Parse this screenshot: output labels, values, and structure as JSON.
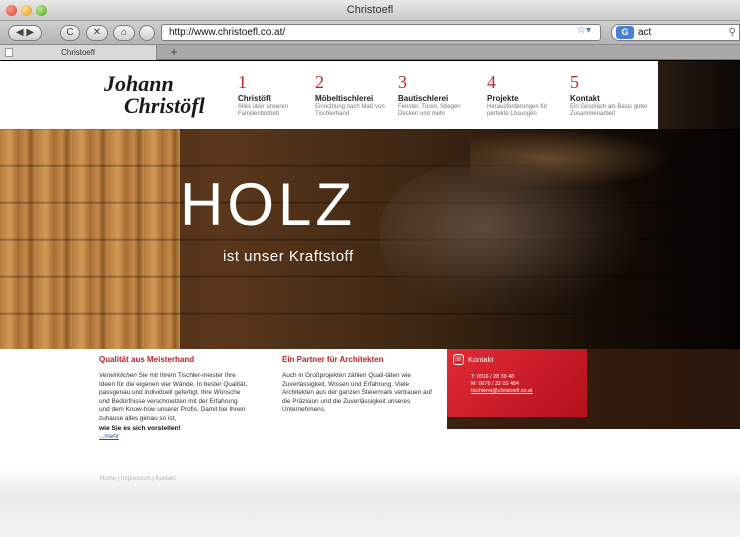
{
  "window": {
    "title": "Christoefl"
  },
  "toolbar": {
    "url": "http://www.christoefl.co.at/",
    "search_value": "act",
    "search_engine_letter": "G",
    "back_label": "◀ ▶",
    "reload_label": "C",
    "stop_label": "✕",
    "home_label": "⌂",
    "star_label": "☆▾"
  },
  "tabs": [
    {
      "label": "Christoefl"
    }
  ],
  "newtab_label": "+",
  "logo": {
    "line1": "Johann",
    "line2": "Christöfl"
  },
  "nav": [
    {
      "num": "1",
      "title": "Christöfl",
      "sub": "Alles über unseren Familienbetrieb"
    },
    {
      "num": "2",
      "title": "Möbeltischlerei",
      "sub": "Einrichtung nach Maß von Tischlerhand"
    },
    {
      "num": "3",
      "title": "Bautischlerei",
      "sub": "Fenster, Türen, Stiegen Decken und mehr"
    },
    {
      "num": "4",
      "title": "Projekte",
      "sub": "Herausforderungen für perfekte Lösungen"
    },
    {
      "num": "5",
      "title": "Kontakt",
      "sub": "Ein Gespräch als Basis guter Zusammenarbeit"
    }
  ],
  "hero": {
    "title": "HOLZ",
    "subtitle": "ist unser Kraftstoff"
  },
  "col1": {
    "title": "Qualität aus Meisterhand",
    "lead_italic": "Verwirklichen",
    "text": " Sie mit Ihrem Tischler-meister Ihre Ideen für die eigenen vier Wände. In bester Qualität, passgenau und individuell gefertigt. Ihre Wünsche und Bedürfnisse verschmelzen mit der Erfahrung und dem Know-how unserer Profis. Damit bei Ihnen zuhause alles genau so ist,",
    "strong": "wie Sie es sich vorstellen!",
    "more": "...mehr"
  },
  "col2": {
    "title": "Ein Partner für Architekten",
    "text": "Auch in Großprojekten zählen Quali-täten wie Zuverlässigkeit, Wissen und Erfahrung. Viele Architekten aus der ganzen Steiermark vertrauen auf die Präzision und die Zuverlässigkeit unseres Unternehmens."
  },
  "kontakt": {
    "title": "Kontakt",
    "phone": "T: 0316 / 28 39 48",
    "mobile": "M: 0676 / 32 03 484",
    "email": "tischlerei@christoefl.co.at"
  },
  "footer": "Home | Impressum | Kontakt"
}
